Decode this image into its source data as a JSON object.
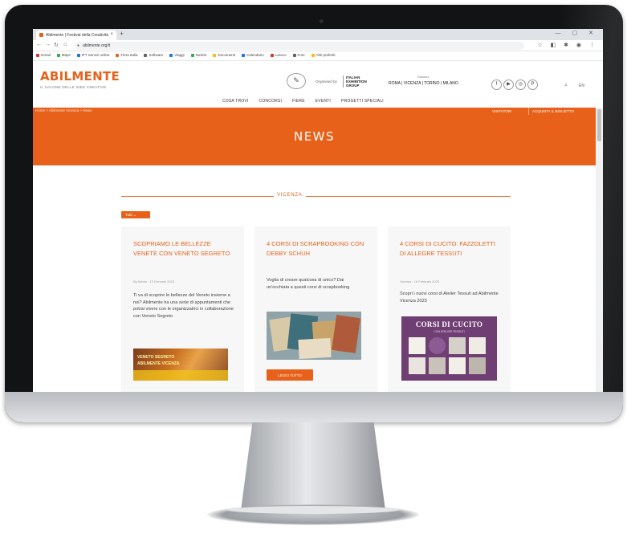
{
  "browser": {
    "tab_title": "Abilmente | Festival della Creatività",
    "tab_close": "×",
    "new_tab": "+",
    "window_controls": "—  ▢  ✕",
    "nav_back": "←",
    "nav_forward": "→",
    "nav_reload": "↻",
    "nav_home": "⌂",
    "url": "abilmente.org/it",
    "extensions": "☆ ◧ ✱ ◉ ⋮",
    "bookmarks": [
      {
        "label": "Gmail",
        "color": "#d93025"
      },
      {
        "label": "Maps",
        "color": "#34a853"
      },
      {
        "label": "IFT Servizi online",
        "color": "#1a73e8"
      },
      {
        "label": "Fiera Italia",
        "color": "#e8611a"
      },
      {
        "label": "Software",
        "color": "#5f6368"
      },
      {
        "label": "Viaggi",
        "color": "#1a73e8"
      },
      {
        "label": "Notizie",
        "color": "#34a853"
      },
      {
        "label": "Documenti",
        "color": "#fbbc04"
      },
      {
        "label": "Calendario",
        "color": "#1a73e8"
      },
      {
        "label": "Lavoro",
        "color": "#d93025"
      },
      {
        "label": "Foto",
        "color": "#5f6368"
      },
      {
        "label": "Altri preferiti",
        "color": "#fbbc04"
      }
    ]
  },
  "header": {
    "logo": "ABILMENTE",
    "tagline": "IL SALONE DELLE IDEE CREATIVE",
    "emblem": "✎",
    "organised_by": "Organised by",
    "partner": "ITALIAN EXHIBITION GROUP",
    "cities_label": "Edizioni",
    "cities": "ROMA | VICENZA | TORINO | MILANO",
    "social": [
      {
        "icon": "facebook-icon",
        "glyph": "f"
      },
      {
        "icon": "youtube-icon",
        "glyph": "▶"
      },
      {
        "icon": "instagram-icon",
        "glyph": "◎"
      },
      {
        "icon": "pinterest-icon",
        "glyph": "P"
      }
    ],
    "search_icon": "⌕",
    "language": "EN",
    "nav": [
      "COSA TROVI",
      "CONCORSI",
      "FIERE",
      "EVENTI",
      "PROGETTI SPECIALI"
    ]
  },
  "breadcrumb": "Home  >  Abilmente Vicenza  >  News",
  "ctas": [
    "VISITATORI",
    "ACQUISTA IL BIGLIETTO"
  ],
  "hero_title": "NEWS",
  "section_label": "VICENZA",
  "filter_label": "Tutti  ⌄",
  "cards": [
    {
      "title": "SCOPRIAMO LE BELLEZZE VENETE CON VENETO SEGRETO",
      "meta": "By Admin  ·  13 Gennaio 2023",
      "excerpt": "Ti va di scoprire le bellezze del Veneto insieme a noi? Abilmente ha una serie di appuntamenti che potrai vivere con le organizzatrici in collaborazione con Veneto Segreto",
      "image_line1": "VENETO SEGRETO",
      "image_line2": "ABILMENTE VICENZA"
    },
    {
      "title": "4 CORSI DI SCRAPBOOKING CON DEBBY SCHUH",
      "excerpt": "Voglia di creare qualcosa di unico? Dai un'occhiata a questi corsi di scrapbooking",
      "button": "LEGGI TUTTO"
    },
    {
      "title": "4 CORSI DI CUCITO: FAZZOLETTI DI ALLEGRE TESSUTI",
      "meta": "Vicenza  ·  16 Febbraio 2023",
      "excerpt": "Scopri i nuovi corsi di Atelier Tessuti ad Abilmente Vicenza 2023",
      "poster_title": "CORSI DI CUCITO",
      "poster_sub": "CON ATELIER TESSUTI"
    }
  ],
  "colors": {
    "brand": "#e8611a",
    "poster": "#6f3f74",
    "bezel": "#121315"
  }
}
